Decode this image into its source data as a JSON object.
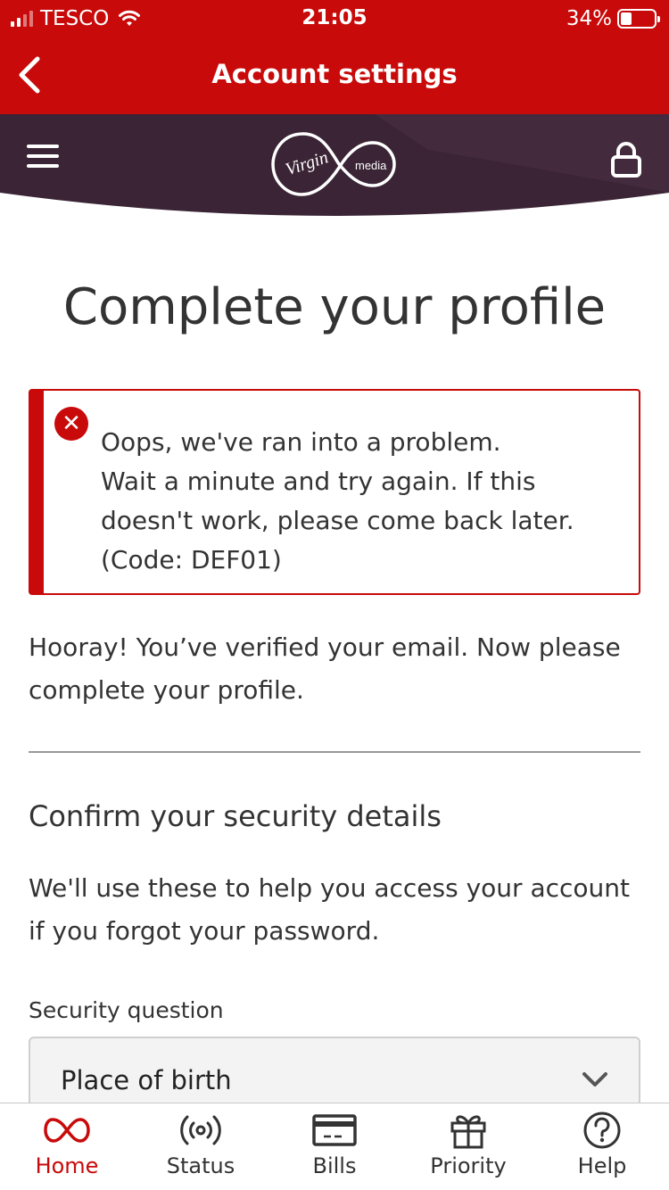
{
  "status_bar": {
    "carrier": "TESCO",
    "time": "21:05",
    "battery_percent": "34%",
    "battery_level": 0.34,
    "signal_bars": 2,
    "text_color": "#ffffff"
  },
  "nav": {
    "title": "Account settings",
    "back_icon": "chevron-left-icon",
    "background": "#c80a0a"
  },
  "brand_bar": {
    "menu_icon": "hamburger-menu-icon",
    "logo": {
      "text_virgin": "Virgin",
      "text_media": "media"
    },
    "lock_icon": "lock-icon",
    "background": "#3a2435"
  },
  "main": {
    "title": "Complete your profile",
    "error": {
      "icon": "error-x-icon",
      "lines": [
        "Oops, we've ran into a problem.",
        "Wait a minute and try again. If this",
        "doesn't work, please come back later.",
        "(Code: DEF01)"
      ],
      "accent": "#c80a0a"
    },
    "verified_text": "Hooray! You’ve verified your email. Now please complete your profile.",
    "security": {
      "heading": "Confirm your security details",
      "description": "We'll use these to help you access your account if you forgot your password.",
      "question_label": "Security question",
      "question_value": "Place of birth"
    }
  },
  "tab_bar": {
    "tabs": [
      {
        "label": "Home",
        "icon": "infinity-icon",
        "active": true
      },
      {
        "label": "Status",
        "icon": "broadcast-icon",
        "active": false
      },
      {
        "label": "Bills",
        "icon": "card-icon",
        "active": false
      },
      {
        "label": "Priority",
        "icon": "gift-icon",
        "active": false
      },
      {
        "label": "Help",
        "icon": "question-icon",
        "active": false
      }
    ],
    "active_color": "#c80a0a"
  }
}
